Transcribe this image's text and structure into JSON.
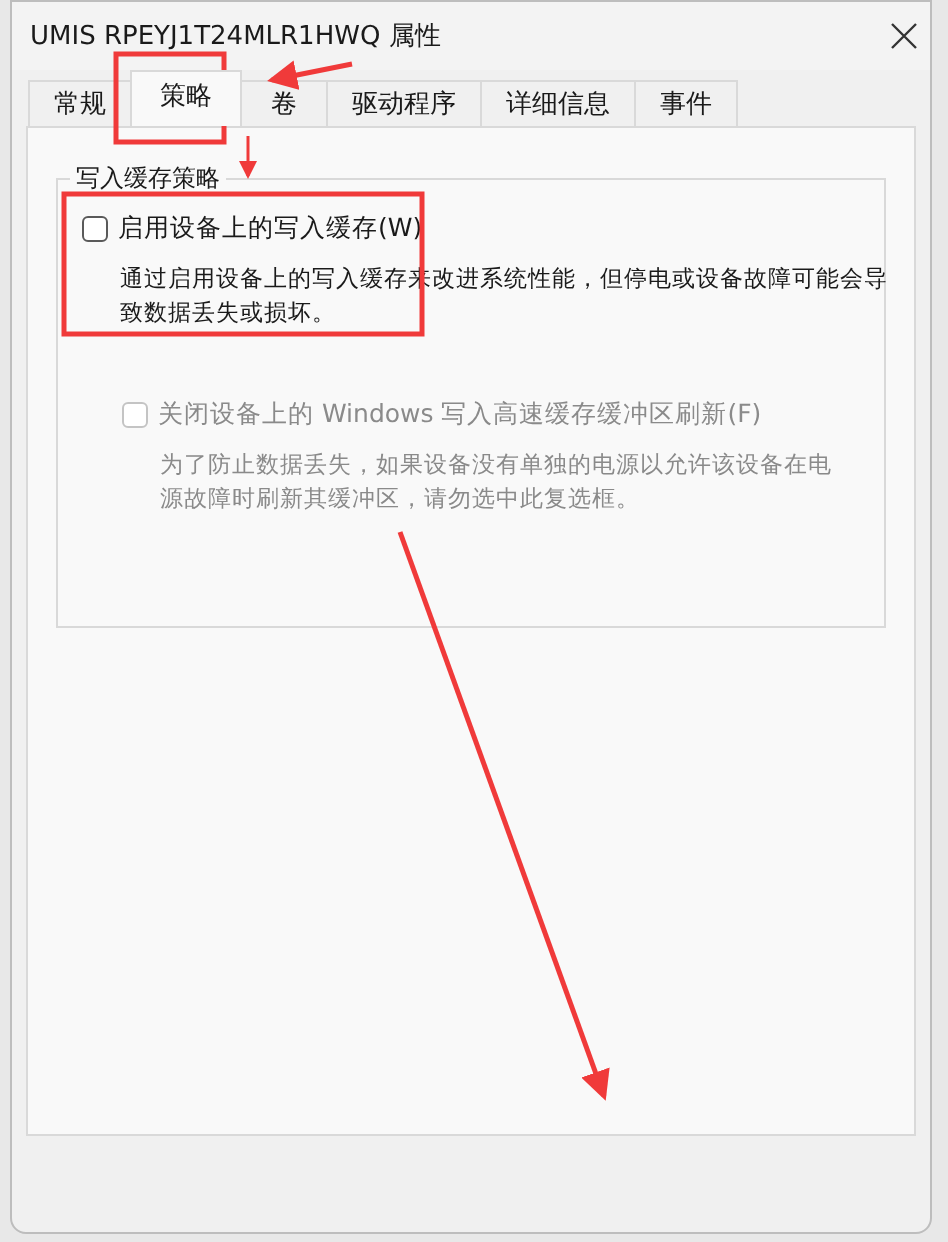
{
  "window": {
    "title": "UMIS RPEYJ1T24MLR1HWQ 属性"
  },
  "tabs": [
    {
      "label": "常规",
      "selected": false
    },
    {
      "label": "策略",
      "selected": true
    },
    {
      "label": "卷",
      "selected": false
    },
    {
      "label": "驱动程序",
      "selected": false
    },
    {
      "label": "详细信息",
      "selected": false
    },
    {
      "label": "事件",
      "selected": false
    }
  ],
  "group": {
    "caption": "写入缓存策略"
  },
  "options": [
    {
      "label": "启用设备上的写入缓存(W)",
      "checked": false,
      "disabled": false,
      "description": "通过启用设备上的写入缓存来改进系统性能，但停电或设备故障可能会导致数据丢失或损坏。"
    },
    {
      "label": "关闭设备上的 Windows 写入高速缓存缓冲区刷新(F)",
      "checked": false,
      "disabled": true,
      "description": "为了防止数据丢失，如果设备没有单独的电源以允许该设备在电源故障时刷新其缓冲区，请勿选中此复选框。"
    }
  ]
}
